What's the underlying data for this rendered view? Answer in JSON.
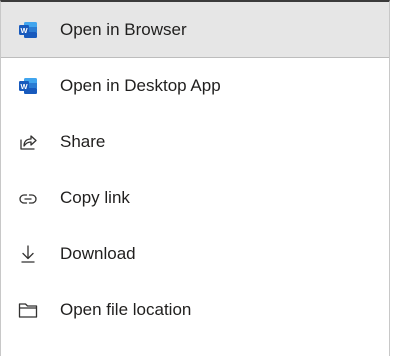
{
  "menu": {
    "items": [
      {
        "label": "Open in Browser",
        "icon": "word-icon",
        "selected": true
      },
      {
        "label": "Open in Desktop App",
        "icon": "word-icon",
        "selected": false
      },
      {
        "label": "Share",
        "icon": "share-icon",
        "selected": false
      },
      {
        "label": "Copy link",
        "icon": "link-icon",
        "selected": false
      },
      {
        "label": "Download",
        "icon": "download-icon",
        "selected": false
      },
      {
        "label": "Open file location",
        "icon": "folder-icon",
        "selected": false
      }
    ]
  },
  "colors": {
    "word_blue": "#185abd",
    "word_light": "#41a5ee",
    "text": "#201f1e",
    "selected_bg": "#e6e6e6"
  }
}
